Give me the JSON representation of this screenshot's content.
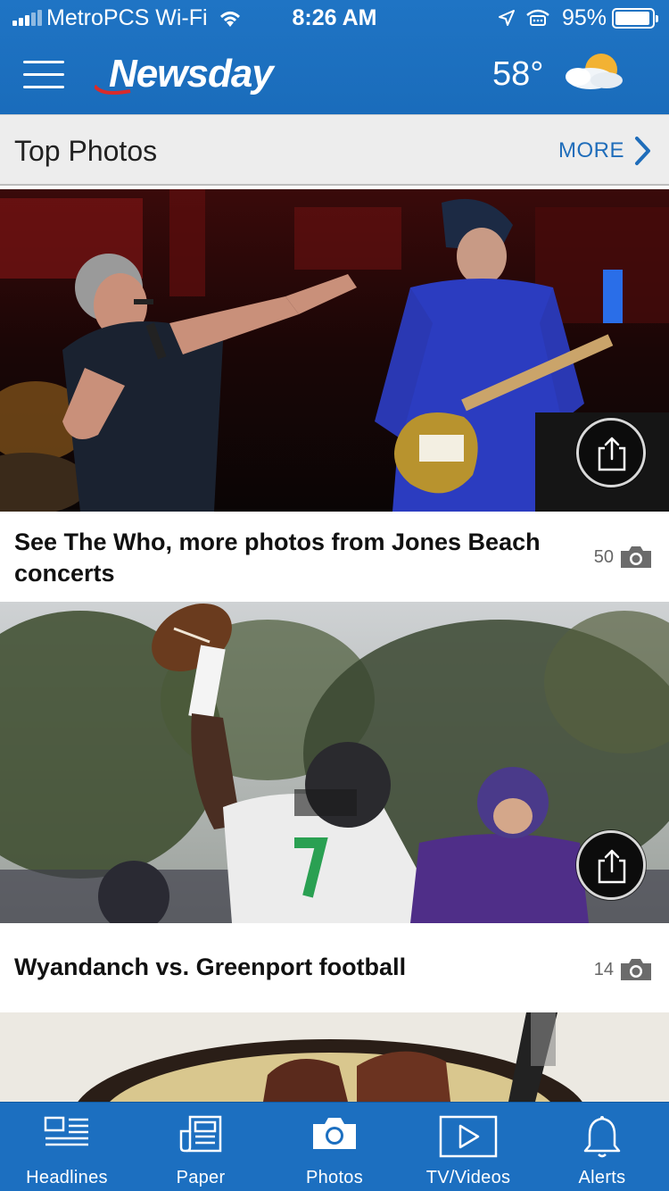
{
  "status_bar": {
    "carrier": "MetroPCS Wi-Fi",
    "time": "8:26 AM",
    "battery_percent": "95%",
    "battery_level": 0.95
  },
  "app_bar": {
    "logo": "Newsday",
    "temperature": "58°",
    "weather_icon": "partly-cloudy-sun",
    "colors": {
      "bar": "#1f74c4",
      "logo_swoosh": "#d92b2b"
    }
  },
  "section": {
    "title": "Top Photos",
    "more_label": "MORE"
  },
  "cards": [
    {
      "caption": "See The Who, more photos from Jones Beach concerts",
      "photo_count": "50"
    },
    {
      "caption": "Wyandanch vs. Greenport football",
      "photo_count": "14"
    },
    {
      "caption": "",
      "photo_count": ""
    }
  ],
  "tabs": [
    {
      "label": "Headlines",
      "icon": "headlines-icon"
    },
    {
      "label": "Paper",
      "icon": "paper-icon"
    },
    {
      "label": "Photos",
      "icon": "camera-icon",
      "active": true
    },
    {
      "label": "TV/Videos",
      "icon": "play-icon"
    },
    {
      "label": "Alerts",
      "icon": "bell-icon"
    }
  ]
}
